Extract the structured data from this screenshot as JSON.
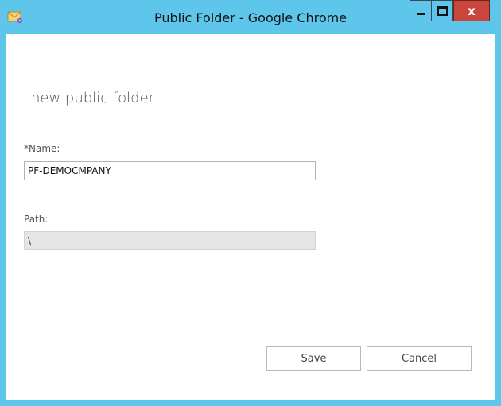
{
  "window": {
    "title": "Public Folder - Google Chrome",
    "close_symbol": "x",
    "icons": {
      "app": "mail-folder-icon",
      "minimize": "minimize-icon",
      "maximize": "maximize-icon",
      "close": "close-icon"
    },
    "colors": {
      "titlebar": "#5ec6ea",
      "close_button": "#c9463d"
    }
  },
  "form": {
    "heading": "new public folder",
    "name_label": "*Name:",
    "name_value": "PF-DEMOCMPANY",
    "path_label": "Path:",
    "path_value": "\\",
    "save_label": "Save",
    "cancel_label": "Cancel"
  }
}
